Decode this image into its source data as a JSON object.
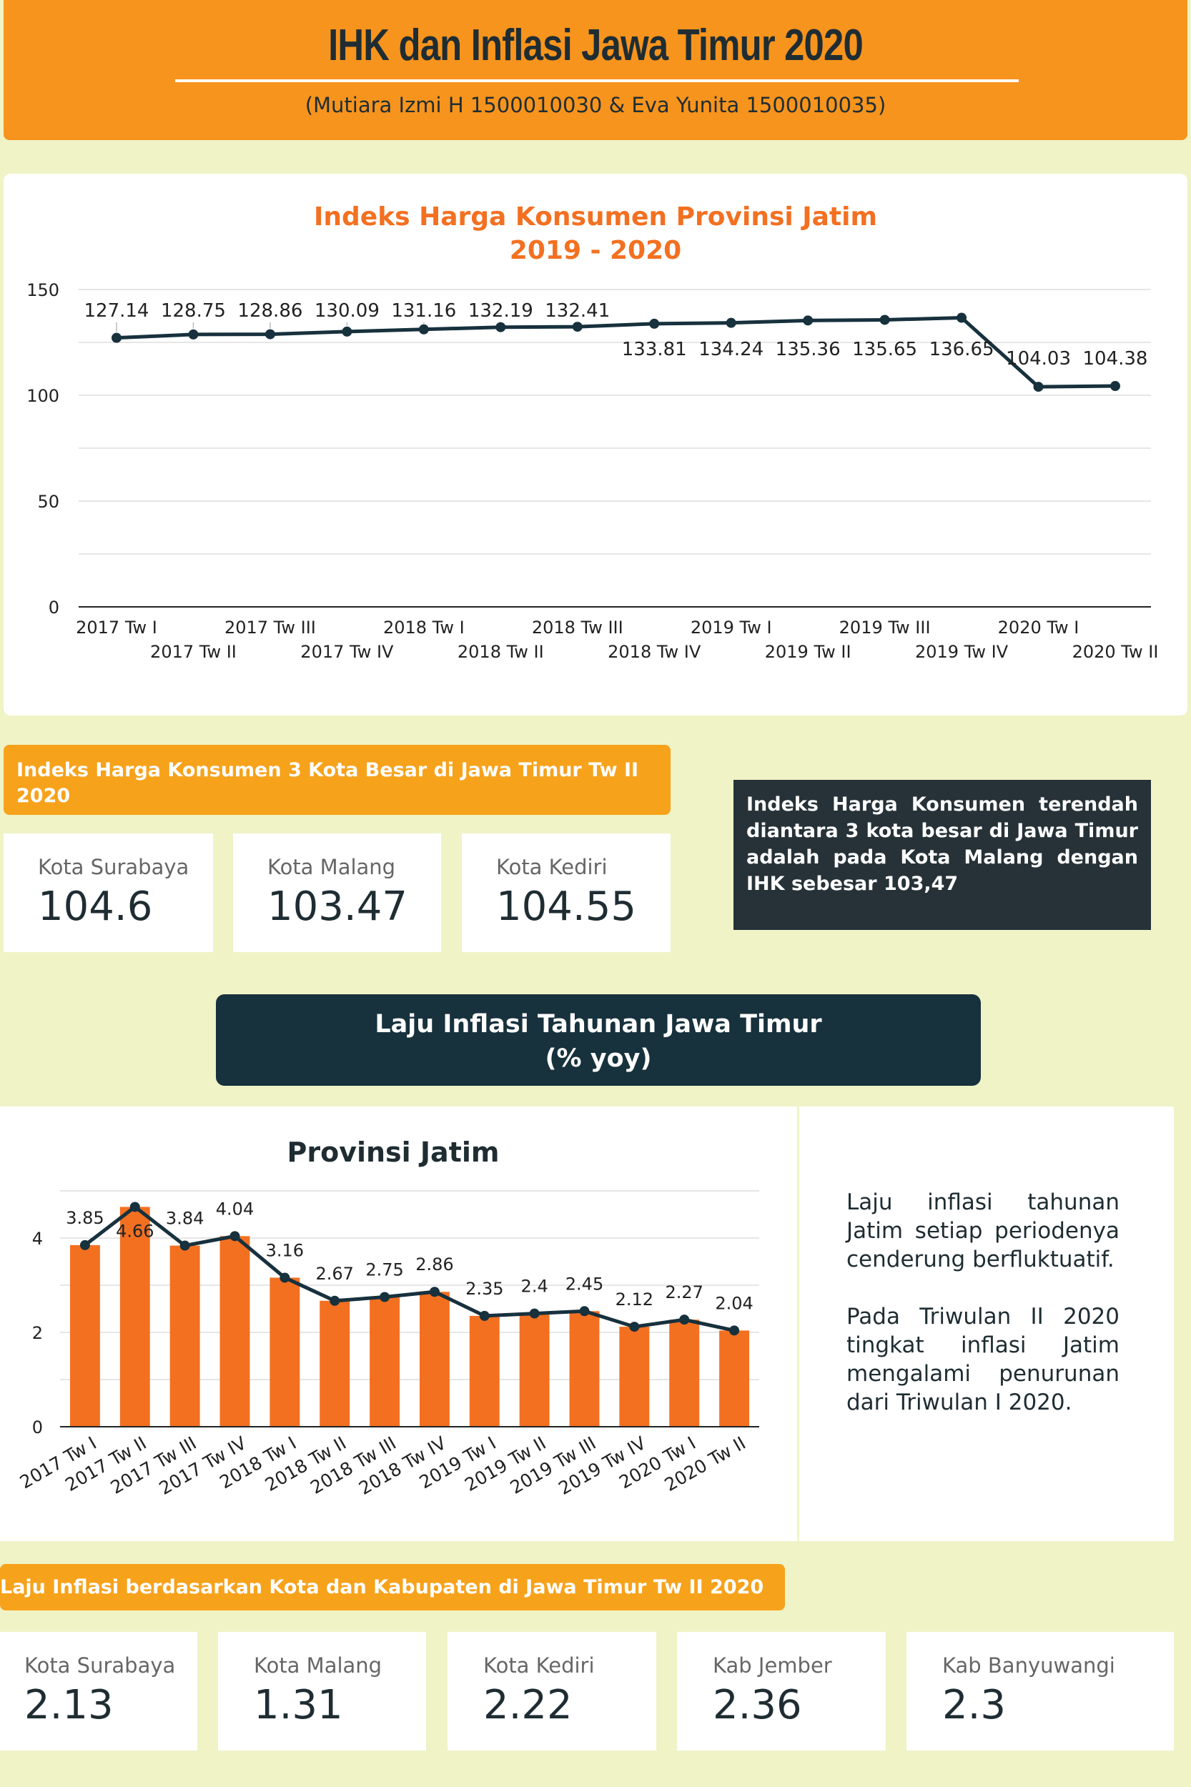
{
  "header": {
    "title": "IHK dan Inflasi Jawa Timur 2020",
    "subtitle": "(Mutiara Izmi H 1500010030 & Eva Yunita 1500010035)",
    "background_color": "#f7941d"
  },
  "ihk_section": {
    "title_line1": "Indeks Harga Konsumen Provinsi Jatim",
    "title_line2": "2019 - 2020"
  },
  "kota_section": {
    "label": "Indeks Harga Konsumen 3 Kota Besar di Jawa Timur Tw II 2020",
    "cards": [
      {
        "name": "Kota Surabaya",
        "value": "104.6"
      },
      {
        "name": "Kota Malang",
        "value": "103.47"
      },
      {
        "name": "Kota Kediri",
        "value": "104.55"
      }
    ],
    "note": "Indeks Harga Konsumen terendah diantara 3 kota besar di Jawa Timur adalah pada Kota Malang dengan IHK sebesar 103,47"
  },
  "laju_section": {
    "header_line1": "Laju Inflasi Tahunan Jawa Timur",
    "header_line2": "(% yoy)",
    "chart_title": "Provinsi Jatim",
    "paragraph1": "Laju inflasi tahunan Jatim setiap periodenya cenderung berfluktuatif.",
    "paragraph2": "Pada Triwulan II 2020 tingkat inflasi Jatim mengalami penurunan dari Triwulan I 2020."
  },
  "kab_section": {
    "label": "Laju Inflasi berdasarkan Kota dan Kabupaten di Jawa Timur Tw II 2020",
    "cards": [
      {
        "name": "Kota Surabaya",
        "value": "2.13"
      },
      {
        "name": "Kota Malang",
        "value": "1.31"
      },
      {
        "name": "Kota Kediri",
        "value": "2.22"
      },
      {
        "name": "Kab Jember",
        "value": "2.36"
      },
      {
        "name": "Kab Banyuwangi",
        "value": "2.3"
      }
    ]
  },
  "chart_data": [
    {
      "type": "line",
      "title": "Indeks Harga Konsumen Provinsi Jatim 2019 - 2020",
      "x": [
        "2017 Tw I",
        "2017 Tw II",
        "2017 Tw III",
        "2017 Tw IV",
        "2018 Tw I",
        "2018 Tw II",
        "2018 Tw III",
        "2018 Tw IV",
        "2019 Tw I",
        "2019 Tw II",
        "2019 Tw III",
        "2019 Tw IV",
        "2020 Tw I",
        "2020 Tw II"
      ],
      "values": [
        127.14,
        128.75,
        128.86,
        130.09,
        131.16,
        132.19,
        132.41,
        133.81,
        134.24,
        135.36,
        135.65,
        136.65,
        104.03,
        104.38
      ],
      "ylim": [
        0,
        150
      ],
      "yticks": [
        0,
        50,
        100,
        150
      ],
      "grid": true,
      "line_color": "#17313d"
    },
    {
      "type": "bar",
      "title": "Provinsi Jatim",
      "categories": [
        "2017 Tw I",
        "2017 Tw II",
        "2017 Tw III",
        "2017 Tw IV",
        "2018 Tw I",
        "2018 Tw II",
        "2018 Tw III",
        "2018 Tw IV",
        "2019 Tw I",
        "2019 Tw II",
        "2019 Tw III",
        "2019 Tw IV",
        "2020 Tw I",
        "2020 Tw II"
      ],
      "series": [
        {
          "type": "bar",
          "values": [
            3.85,
            4.66,
            3.84,
            4.04,
            3.16,
            2.67,
            2.75,
            2.86,
            2.35,
            2.4,
            2.45,
            2.12,
            2.27,
            2.04
          ]
        },
        {
          "type": "line",
          "values": [
            3.85,
            4.66,
            3.84,
            4.04,
            3.16,
            2.67,
            2.75,
            2.86,
            2.35,
            2.4,
            2.45,
            2.12,
            2.27,
            2.04
          ]
        }
      ],
      "ylim": [
        0,
        5
      ],
      "yticks": [
        0,
        2,
        4
      ],
      "grid": true,
      "bar_color": "#f37021",
      "line_color": "#17313d"
    }
  ]
}
